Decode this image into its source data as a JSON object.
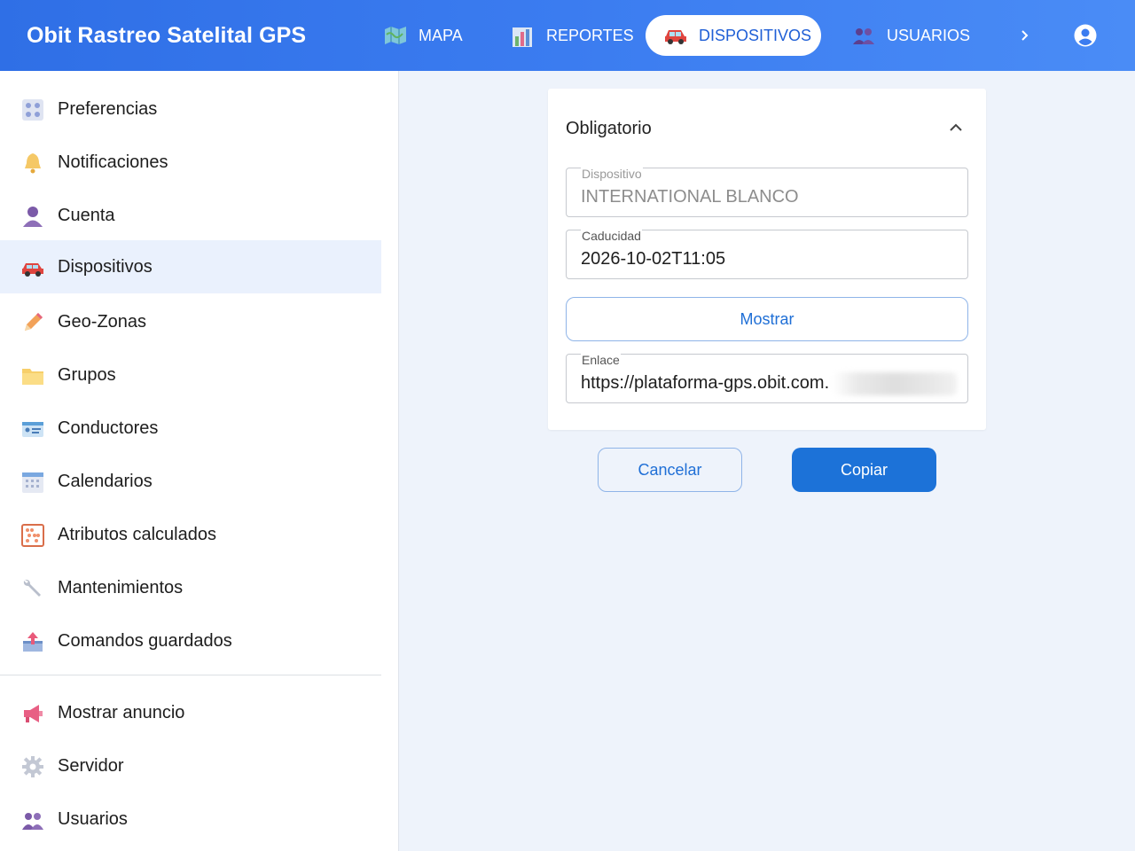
{
  "app": {
    "title": "Obit Rastreo Satelital GPS"
  },
  "nav": {
    "tabs": [
      {
        "label": "MAPA",
        "icon": "map-icon"
      },
      {
        "label": "REPORTES",
        "icon": "chart-icon"
      },
      {
        "label": "DISPOSITIVOS",
        "icon": "car-icon",
        "active": true
      },
      {
        "label": "USUARIOS",
        "icon": "users-icon"
      }
    ],
    "more_icon": "chevron-right-icon",
    "account_icon": "account-circle-icon"
  },
  "sidebar": {
    "items": [
      {
        "label": "Preferencias",
        "icon": "preferences-icon"
      },
      {
        "label": "Notificaciones",
        "icon": "bell-icon"
      },
      {
        "label": "Cuenta",
        "icon": "person-icon"
      },
      {
        "label": "Dispositivos",
        "icon": "car-icon",
        "active": true
      },
      {
        "label": "Geo-Zonas",
        "icon": "pencil-icon"
      },
      {
        "label": "Grupos",
        "icon": "folder-icon"
      },
      {
        "label": "Conductores",
        "icon": "id-card-icon"
      },
      {
        "label": "Calendarios",
        "icon": "calendar-icon"
      },
      {
        "label": "Atributos calculados",
        "icon": "abacus-icon"
      },
      {
        "label": "Mantenimientos",
        "icon": "wrench-icon"
      },
      {
        "label": "Comandos guardados",
        "icon": "outbox-icon"
      }
    ],
    "secondary_items": [
      {
        "label": "Mostrar anuncio",
        "icon": "megaphone-icon"
      },
      {
        "label": "Servidor",
        "icon": "gear-icon"
      },
      {
        "label": "Usuarios",
        "icon": "users-icon"
      }
    ]
  },
  "form": {
    "section_title": "Obligatorio",
    "device": {
      "label": "Dispositivo",
      "value": "INTERNATIONAL BLANCO"
    },
    "expiration": {
      "label": "Caducidad",
      "value": "2026-10-02T11:05"
    },
    "show_button": "Mostrar",
    "link": {
      "label": "Enlace",
      "value": "https://plataforma-gps.obit.com."
    }
  },
  "actions": {
    "cancel": "Cancelar",
    "copy": "Copiar"
  },
  "colors": {
    "header": "#3b7cf0",
    "accent": "#1c72d8",
    "active_bg": "#eaf1fd"
  }
}
